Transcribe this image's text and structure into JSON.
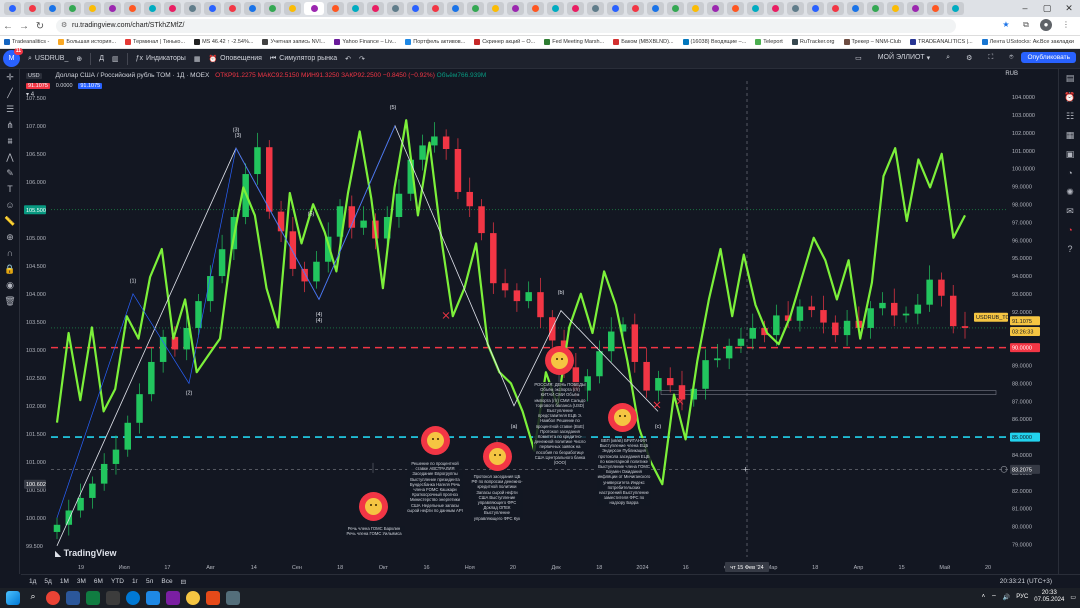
{
  "browser": {
    "url": "ru.tradingview.com/chart/STkhZMfZ/",
    "bookmarks": [
      "Tradeanalitics -",
      "Большая история...",
      "Терминал | Тинько...",
      "MS 46.42 ↑ -2.54%...",
      "Учетная запись NVI...",
      "Yahoo Finance – Liv...",
      "Портфель активов...",
      "Скринер акций – О...",
      "Fed Meeting Marsh...",
      "Баком (MBXBLND)...",
      "(16038) Входящие –...",
      "Teleport",
      "RuTracker.org",
      "Трекер – NNM-Club",
      "TRADEANALITICS |...",
      "Лента USstocks: Ак..."
    ],
    "bookmarks_all": "Все закладки"
  },
  "header": {
    "symbol": "USDRUB_",
    "indicators": "Индикаторы",
    "alerts": "Оповещения",
    "replay": "Симулятор рынка",
    "layout_name": "МОЙ ЭЛЛИОТ",
    "publish": "Опубликовать"
  },
  "legend": {
    "currency_badge": "USD",
    "title": "Доллар США / Российский рубль TOM · 1Д · MOEX",
    "ohlc": "ОТКР91.2275 МАКС92.5150 МИН91.3250 ЗАКР92.2500 −0.8450 (−0.92%)",
    "volume": "Объём766.939M",
    "price_sell": "91.1075",
    "spread": "0.0000",
    "price_buy": "91.1075",
    "lot": "4"
  },
  "chart_data": {
    "type": "candlestick",
    "title": "Доллар США / Российский рубль TOM · 1Д · MOEX",
    "left_axis": {
      "ticks": [
        "107.500",
        "107.000",
        "106.500",
        "106.000",
        "105.500",
        "105.000",
        "104.500",
        "104.000",
        "103.500",
        "103.000",
        "102.500",
        "102.000",
        "101.500",
        "101.000",
        "100.500",
        "100.000",
        "99.500"
      ],
      "ylim": [
        99.3,
        107.8
      ]
    },
    "right_axis": {
      "currency": "RUB",
      "ticks": [
        "104.0000",
        "103.0000",
        "102.0000",
        "101.0000",
        "100.0000",
        "99.0000",
        "98.0000",
        "97.0000",
        "96.0000",
        "95.0000",
        "94.0000",
        "93.0000",
        "92.0000",
        "91.0000",
        "90.0000",
        "89.0000",
        "88.0000",
        "87.0000",
        "86.0000",
        "85.0000",
        "84.0000",
        "83.0000",
        "82.0000",
        "81.0000",
        "80.0000",
        "79.0000"
      ],
      "ylim": [
        78.3,
        104.9
      ]
    },
    "x_ticks": [
      "19",
      "Июл",
      "17",
      "Авг",
      "14",
      "Сен",
      "18",
      "Окт",
      "16",
      "Ноя",
      "20",
      "Дек",
      "18",
      "2024",
      "16",
      "Фев",
      "Мар",
      "18",
      "Апр",
      "15",
      "Май",
      "20"
    ],
    "crosshair_date": "чт 15 Фев '24",
    "price_labels": {
      "left_green": "105.500",
      "left_crosshair": "100.602",
      "symbol_tag": "USDRUB_TOM",
      "last_price": "91.1075",
      "countdown": "03:26:33",
      "line_red": "90.0000",
      "line_cyan": "85.0000",
      "crosshair_right": "83.2075"
    },
    "horizontal_lines": [
      {
        "price": 90.0,
        "color": "#f23645",
        "style": "dashed"
      },
      {
        "price": 85.0,
        "color": "#22d3ee",
        "style": "dashed"
      }
    ],
    "wave_labels": [
      "(1)",
      "(2)",
      "(3)",
      "(4)",
      "(5)",
      "(3)",
      "(4)",
      "(5)",
      "(a)",
      "(b)",
      "(c)"
    ],
    "closes": [
      80.1,
      80.9,
      81.6,
      82.4,
      83.5,
      84.3,
      85.8,
      87.4,
      89.2,
      90.6,
      89.9,
      91.1,
      92.6,
      94.0,
      95.5,
      97.3,
      99.7,
      101.2,
      97.6,
      96.5,
      94.4,
      93.7,
      94.8,
      96.2,
      97.9,
      96.7,
      97.1,
      96.1,
      97.3,
      98.6,
      100.5,
      101.3,
      101.8,
      101.1,
      98.7,
      97.9,
      96.4,
      93.6,
      93.2,
      92.6,
      93.1,
      91.7,
      90.4,
      88.9,
      87.6,
      88.4,
      89.8,
      90.9,
      91.3,
      89.2,
      87.6,
      88.3,
      87.9,
      87.1,
      87.7,
      89.3,
      89.4,
      90.1,
      90.5,
      91.1,
      90.7,
      91.8,
      91.5,
      92.3,
      92.1,
      91.4,
      90.7,
      91.5,
      91.1,
      92.2,
      92.5,
      91.8,
      91.9,
      92.4,
      93.8,
      92.9,
      91.2,
      91.1
    ],
    "green_line_left_axis": [
      101.7,
      103.3,
      102.1,
      103.4,
      101.9,
      102.3,
      103.6,
      103.2,
      104.3,
      104.8,
      103.2,
      103.9,
      102.6,
      102.9,
      103.2,
      104.8,
      105.9,
      105.4,
      104.1,
      103.4,
      105.8,
      104.9,
      105.6,
      105.1,
      104.4,
      105.8,
      106.9,
      105.7,
      104.1,
      105.9,
      107.1,
      105.4,
      106.7,
      105.0,
      103.6,
      104.1,
      104.9,
      103.1,
      102.6,
      102.4,
      101.9,
      101.2,
      102.6,
      102.0,
      103.4,
      104.0,
      103.3,
      104.4,
      103.8,
      102.8,
      101.6,
      101.0,
      100.6,
      102.2,
      101.4,
      102.8,
      103.9,
      104.8,
      103.6,
      104.7,
      103.8,
      103.3,
      103.1,
      103.6,
      104.3,
      105.0,
      104.6,
      103.9,
      104.6,
      103.2,
      104.2,
      106.1,
      106.6,
      105.3,
      106.4,
      105.9,
      106.5,
      105.0,
      105.4
    ]
  },
  "annotations": [
    {
      "text": "Речь члена ГОМС Барклин Речь члена ГОМС Уильямса"
    },
    {
      "text": "Решение по процентной ставке АВСТРАЛИЯ Заседание Еврогруппы Выступление президента Бундесбанка Нагеля Речь члена FOMC Кашкари Краткосрочный прогноз Министерство энергетики США Недельные запасы сырой нефти по данным API"
    },
    {
      "text": "Протокол заседания ЦБ РФ по вопросам денежно-кредитной политики Запасы сырой нефти США Выступление управляющего ФРС Доклад ОПЕК Выступление управляющего ФРС Кук"
    },
    {
      "text": "РОССИЯ: ДЕНЬ ПОБЕДЫ Объём экспорта (г/г) КИТАЙ СМИ Объём импорта (г/г) СМИ Сальдо торгового баланса (USD) Выступление представителя ЕЦБ Э. Намбол Решение по процентной ставке (BoE) Протокол заседания Комитета по кредитно-денежной политике Число первичных заявок на пособия по безработице США Центрального банка (ООО)"
    },
    {
      "text": "ВВП (кв/кв) БРИТАНИЯ Выступление члена ЕЦБ Эндерсон Публикация протокола заседания ЕЦБ по монетарной политике Выступление члена ГОМС Боумен Ожидания инфляции от Мичиганского университета Индекс потребительских настроений Выступление заместителя ФРС по надзору Барра"
    }
  ],
  "watermark": "TradingView",
  "timebar": {
    "timeframes": [
      "1д",
      "5д",
      "1М",
      "3М",
      "6М",
      "YTD",
      "1г",
      "5л",
      "Все"
    ],
    "clock": "20:33:21 (UTC+3)"
  },
  "taskbar": {
    "time": "20:33",
    "date": "07.05.2024",
    "lang": "РУС"
  },
  "colors": {
    "up": "#22c55e",
    "down": "#f23645",
    "green_line": "#7cf03a",
    "wave_line": "#e0e3eb",
    "wave_blue": "#2962ff",
    "bg": "#131722"
  }
}
